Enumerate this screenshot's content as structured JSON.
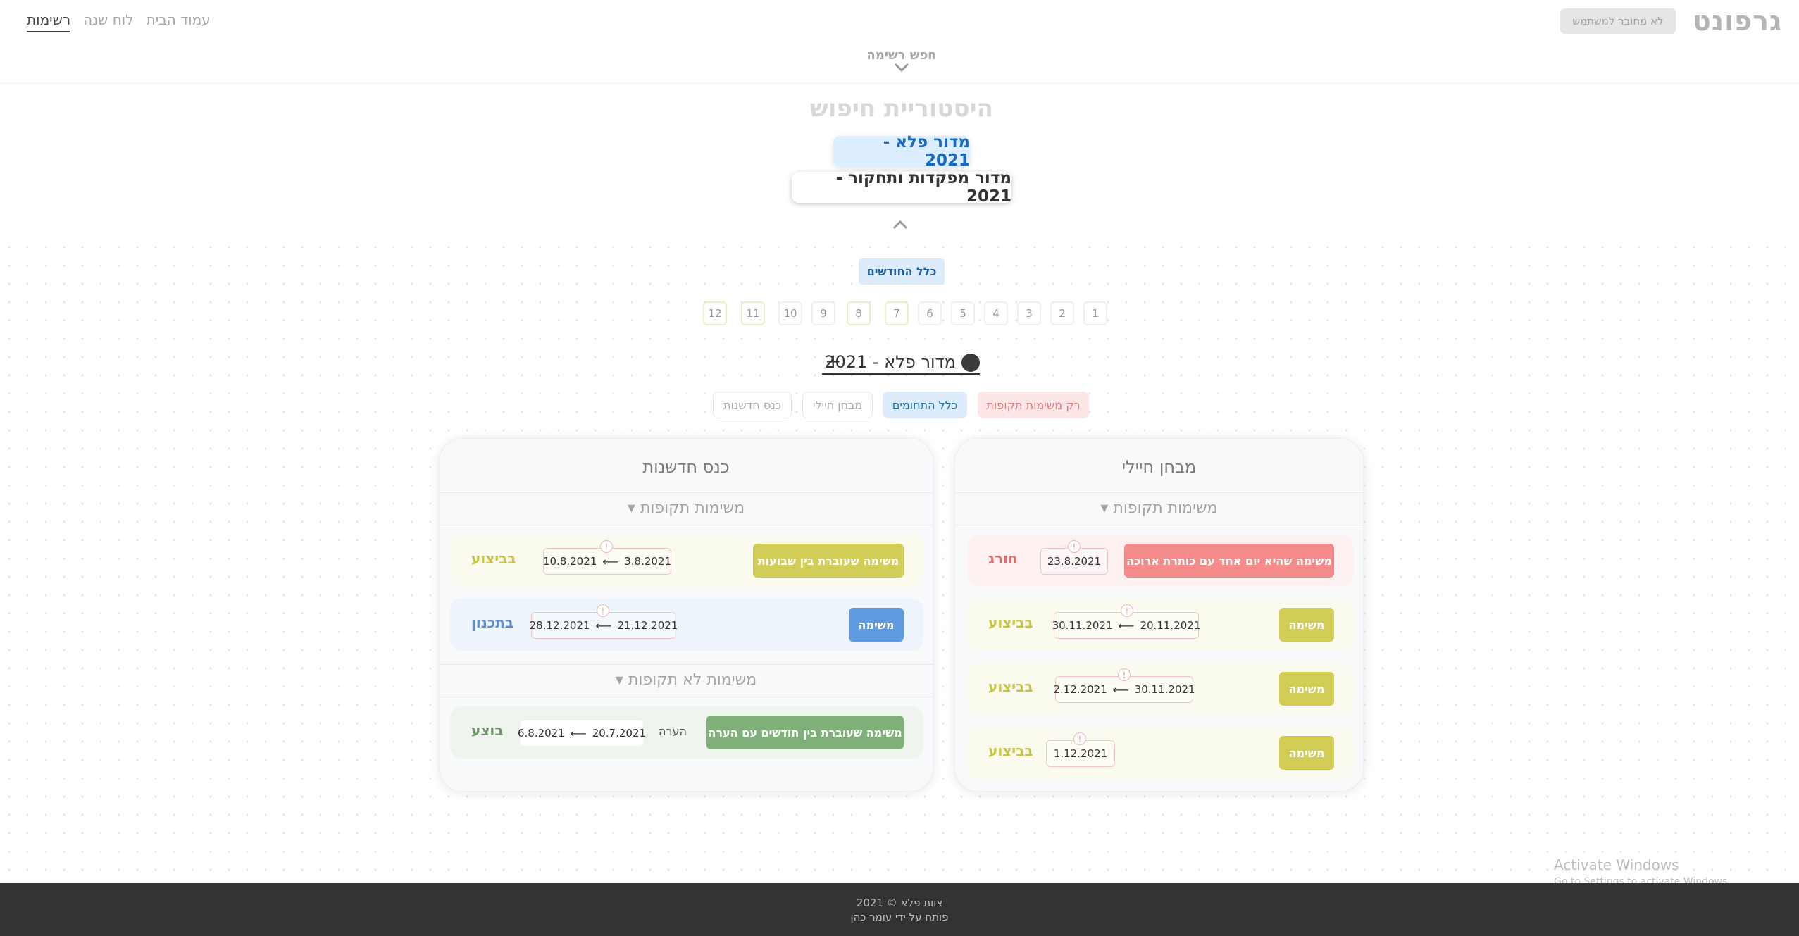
{
  "app": {
    "brand": "גרפונט",
    "user_button": "לא מחובר למשתמש"
  },
  "nav": {
    "items": [
      "רשימות",
      "לוח שנה",
      "עמוד הבית"
    ],
    "active": "רשימות"
  },
  "search": {
    "toggle_label": "חפש רשימה"
  },
  "history": {
    "title": "היסטוריית חיפוש",
    "items": [
      "מדור פלא - 2021",
      "מדור מפקדות ותחקור - 2021"
    ]
  },
  "months": {
    "all_label": "כלל החודשים",
    "items": [
      "1",
      "2",
      "3",
      "4",
      "5",
      "6",
      "7",
      "8",
      "9",
      "10",
      "11",
      "12"
    ],
    "highlighted": [
      "7",
      "8",
      "11",
      "12"
    ]
  },
  "department": {
    "name": "מדור פלא - 2021",
    "add_icon": "plus-icon"
  },
  "filters": {
    "urgent_only": "רק משימות תקופות",
    "all_domains": "כלל התחומים",
    "hayali": "מבחן חיילי",
    "knes": "כנס חדשנות"
  },
  "cards": {
    "right": {
      "title": "מבחן חיילי",
      "sections": [
        {
          "title": "משימות תקופות",
          "tasks": [
            {
              "name": "משימה שהיא יום אחד עם כותרת ארוכה",
              "start": "23.8.2021",
              "end": "",
              "status": "חורג",
              "color": "#f48a8a"
            },
            {
              "name": "משימה",
              "start": "20.11.2021",
              "end": "30.11.2021",
              "status": "בביצוע",
              "color": "#d2cd57"
            },
            {
              "name": "משימה",
              "start": "30.11.2021",
              "end": "2.12.2021",
              "status": "בביצוע",
              "color": "#d2cd57"
            },
            {
              "name": "משימה",
              "start": "1.12.2021",
              "end": "",
              "status": "בביצוע",
              "color": "#d2cd57"
            }
          ]
        }
      ]
    },
    "left": {
      "title": "כנס חדשנות",
      "sections": [
        {
          "title": "משימות תקופות",
          "tasks": [
            {
              "name": "משימה שעוברת בין שבועות",
              "start": "3.8.2021",
              "end": "10.8.2021",
              "status": "בביצוע",
              "color": "#d2cd57"
            },
            {
              "name": "משימה",
              "start": "21.12.2021",
              "end": "28.12.2021",
              "status": "בתכנון",
              "color": "#5d9ae2"
            }
          ]
        },
        {
          "title": "משימות לא תקופות",
          "tasks": [
            {
              "name": "משימה שעוברת בין חודשים עם הערה",
              "note": "הערה",
              "start": "20.7.2021",
              "end": "6.8.2021",
              "status": "בוצע",
              "color": "#7fb07a"
            }
          ]
        }
      ]
    }
  },
  "watermark": {
    "line1": "Activate Windows",
    "line2": "Go to Settings to activate Windows."
  },
  "footer": {
    "line1": "צוות פלא © 2021",
    "line2": "פותח על ידי עומר כהן"
  }
}
